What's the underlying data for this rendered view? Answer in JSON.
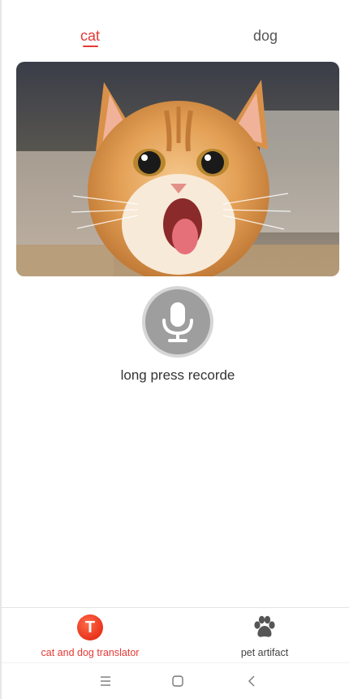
{
  "tabs": [
    {
      "label": "cat",
      "active": true
    },
    {
      "label": "dog",
      "active": false
    }
  ],
  "photo": {
    "subject": "orange cat with mouth open"
  },
  "record": {
    "label": "long press recorde",
    "icon": "microphone-icon"
  },
  "bottom_nav": [
    {
      "label": "cat and dog translator",
      "icon": "translator-t-icon",
      "active": true,
      "badge_letter": "T"
    },
    {
      "label": "pet artifact",
      "icon": "paw-icon",
      "active": false
    }
  ],
  "system_bar": {
    "menu_icon": "menu-icon",
    "home_icon": "home-square-icon",
    "back_icon": "back-chevron-icon"
  },
  "colors": {
    "accent": "#e53935",
    "mic_button": "#9e9e9e",
    "text": "#333333"
  }
}
